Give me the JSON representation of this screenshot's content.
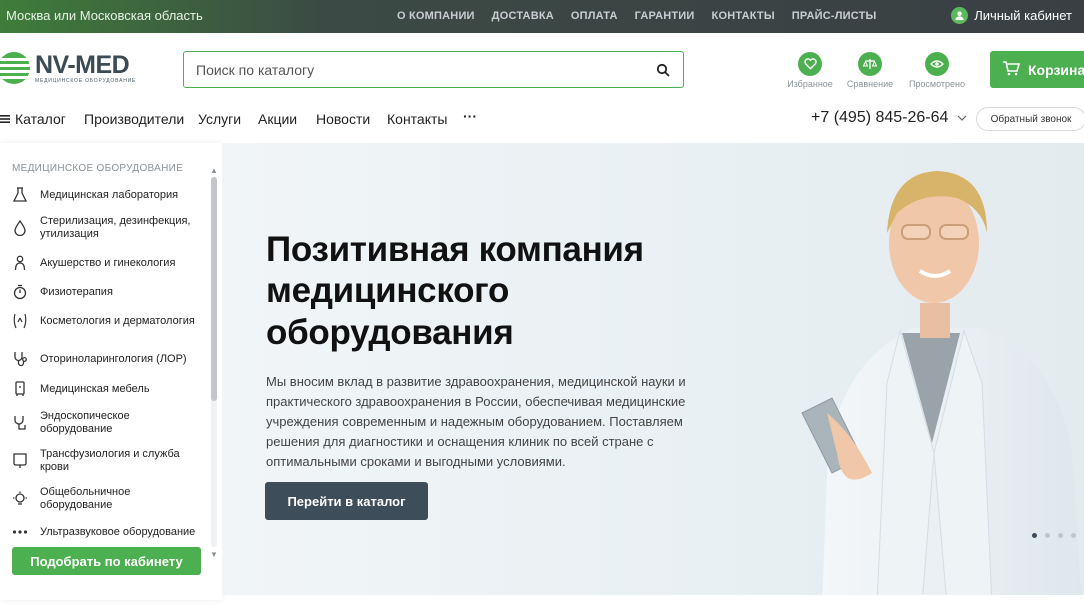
{
  "topbar": {
    "region": "Москва или Московская область",
    "nav": [
      "О КОМПАНИИ",
      "ДОСТАВКА",
      "ОПЛАТА",
      "ГАРАНТИИ",
      "КОНТАКТЫ",
      "ПРАЙС-ЛИСТЫ"
    ],
    "account": "Личный кабинет"
  },
  "logo": {
    "name": "NV-MED",
    "tagline": "МЕДИЦИНСКОЕ ОБОРУДОВАНИЕ"
  },
  "search": {
    "placeholder": "Поиск по каталогу",
    "value": ""
  },
  "header_icons": {
    "favorites": "Избранное",
    "compare": "Сравнение",
    "viewed": "Просмотрено"
  },
  "cart": {
    "label": "Корзина"
  },
  "mainnav": {
    "catalog": "Каталог",
    "items": [
      "Производители",
      "Услуги",
      "Акции",
      "Новости",
      "Контакты"
    ],
    "more": "···"
  },
  "phone": "+7 (495) 845-26-64",
  "callback": "Обратный звонок",
  "sidebar": {
    "title": "МЕДИЦИНСКОЕ ОБОРУДОВАНИЕ",
    "items": [
      {
        "label": "Медицинская лаборатория",
        "icon": "flask-icon"
      },
      {
        "label": "Стерилизация, дезинфекция, утилизация",
        "icon": "drop-icon"
      },
      {
        "label": "Акушерство и гинекология",
        "icon": "person-icon"
      },
      {
        "label": "Физиотерапия",
        "icon": "stopwatch-icon"
      },
      {
        "label": "Косметология и дерматология",
        "icon": "body-icon"
      },
      {
        "label": "Оториноларингология (ЛОР)",
        "icon": "stethoscope-icon"
      },
      {
        "label": "Медицинская мебель",
        "icon": "furniture-icon"
      },
      {
        "label": "Эндоскопическое оборудование",
        "icon": "endoscope-icon"
      },
      {
        "label": "Трансфузиология и служба крови",
        "icon": "blood-bag-icon"
      },
      {
        "label": "Общебольничное оборудование",
        "icon": "lamp-icon"
      },
      {
        "label": "Ультразвуковое оборудование",
        "icon": "dots-icon"
      }
    ],
    "pick_button": "Подобрать по кабинету"
  },
  "hero": {
    "title": "Позитивная компания медицинского оборудования",
    "text": "Мы вносим вклад в развитие здравоохранения, медицинской науки и практического здравоохранения в России, обеспечивая медицинские учреждения современным и надежным оборудованием. Поставляем решения для диагностики и оснащения клиник по всей стране с оптимальными сроками и выгодными условиями.",
    "cta": "Перейти в каталог",
    "slide_active": 1,
    "slide_count": 4
  },
  "colors": {
    "accent": "#4caf50",
    "dark": "#3d4d59",
    "topbar": "#3a3f44"
  }
}
